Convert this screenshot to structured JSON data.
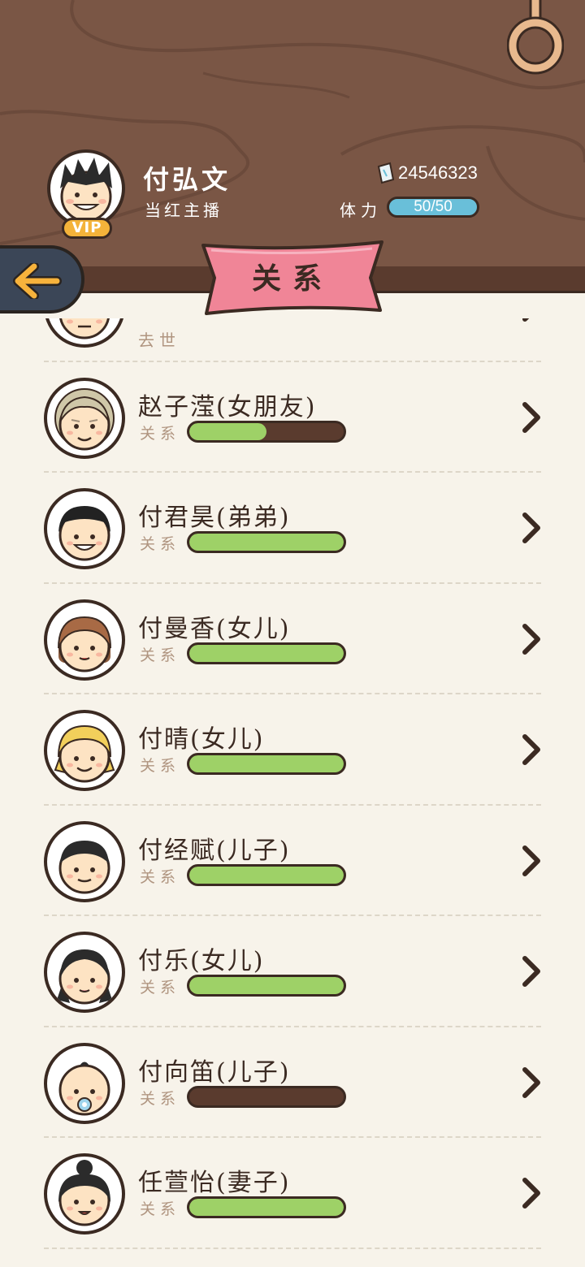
{
  "player": {
    "name": "付弘文",
    "title": "当红主播",
    "vip": "VIP",
    "money": "24546323",
    "stamina_label": "体力",
    "stamina": "50/50"
  },
  "header": {
    "tab_title": "关系"
  },
  "relations": [
    {
      "name": "",
      "status": "去世",
      "relation_label": "",
      "relation_level": null,
      "portrait": "elder-portrait"
    },
    {
      "name": "赵子滢(女朋友)",
      "relation_label": "关系",
      "relation_level": 0.5,
      "portrait": "elderly-woman-portrait"
    },
    {
      "name": "付君昊(弟弟)",
      "relation_label": "关系",
      "relation_level": 1.0,
      "portrait": "grinning-man-portrait"
    },
    {
      "name": "付曼香(女儿)",
      "relation_label": "关系",
      "relation_level": 1.0,
      "portrait": "brown-hair-girl-portrait"
    },
    {
      "name": "付晴(女儿)",
      "relation_label": "关系",
      "relation_level": 1.0,
      "portrait": "blonde-girl-portrait"
    },
    {
      "name": "付经赋(儿子)",
      "relation_label": "关系",
      "relation_level": 1.0,
      "portrait": "boy-portrait"
    },
    {
      "name": "付乐(女儿)",
      "relation_label": "关系",
      "relation_level": 1.0,
      "portrait": "pigtail-girl-portrait"
    },
    {
      "name": "付向笛(儿子)",
      "relation_label": "关系",
      "relation_level": 0.0,
      "portrait": "baby-pacifier-portrait"
    },
    {
      "name": "任萱怡(妻子)",
      "relation_label": "关系",
      "relation_level": 1.0,
      "portrait": "bun-woman-portrait"
    }
  ],
  "colors": {
    "wood": "#7a5645",
    "ledge": "#5a3b2e",
    "outline": "#3b2a22",
    "ribbon": "#f08597",
    "bar_fill": "#9ed167",
    "bar_empty": "#5a3b2e",
    "stamina": "#69bfd9",
    "vip": "#f4b33a",
    "back_button": "#3b4657",
    "back_arrow": "#f7b33c",
    "background": "#f7f3ea"
  }
}
